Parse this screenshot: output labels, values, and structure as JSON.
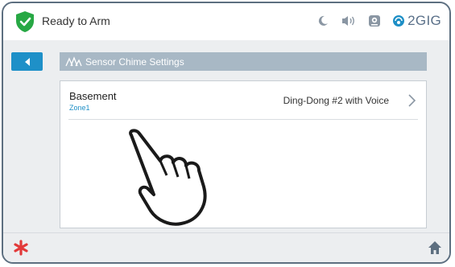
{
  "status": {
    "text": "Ready to Arm",
    "shield_icon": "shield-check-icon",
    "icons": [
      "moon-icon",
      "speaker-icon",
      "camera-icon"
    ],
    "brand": "2GIG"
  },
  "header": {
    "back_icon": "back-arrow-icon",
    "title": "Sensor Chime Settings",
    "title_icon": "chime-icon"
  },
  "sensors": [
    {
      "name": "Basement",
      "zone": "Zone1",
      "chime": "Ding-Dong #2 with Voice"
    }
  ],
  "footer": {
    "emergency_icon": "emergency-asterisk-icon",
    "home_icon": "home-icon"
  },
  "colors": {
    "accent_blue": "#1e90c8",
    "shield_green": "#27a844",
    "title_bar": "#a8b8c5",
    "emergency_red": "#e23a3a"
  }
}
